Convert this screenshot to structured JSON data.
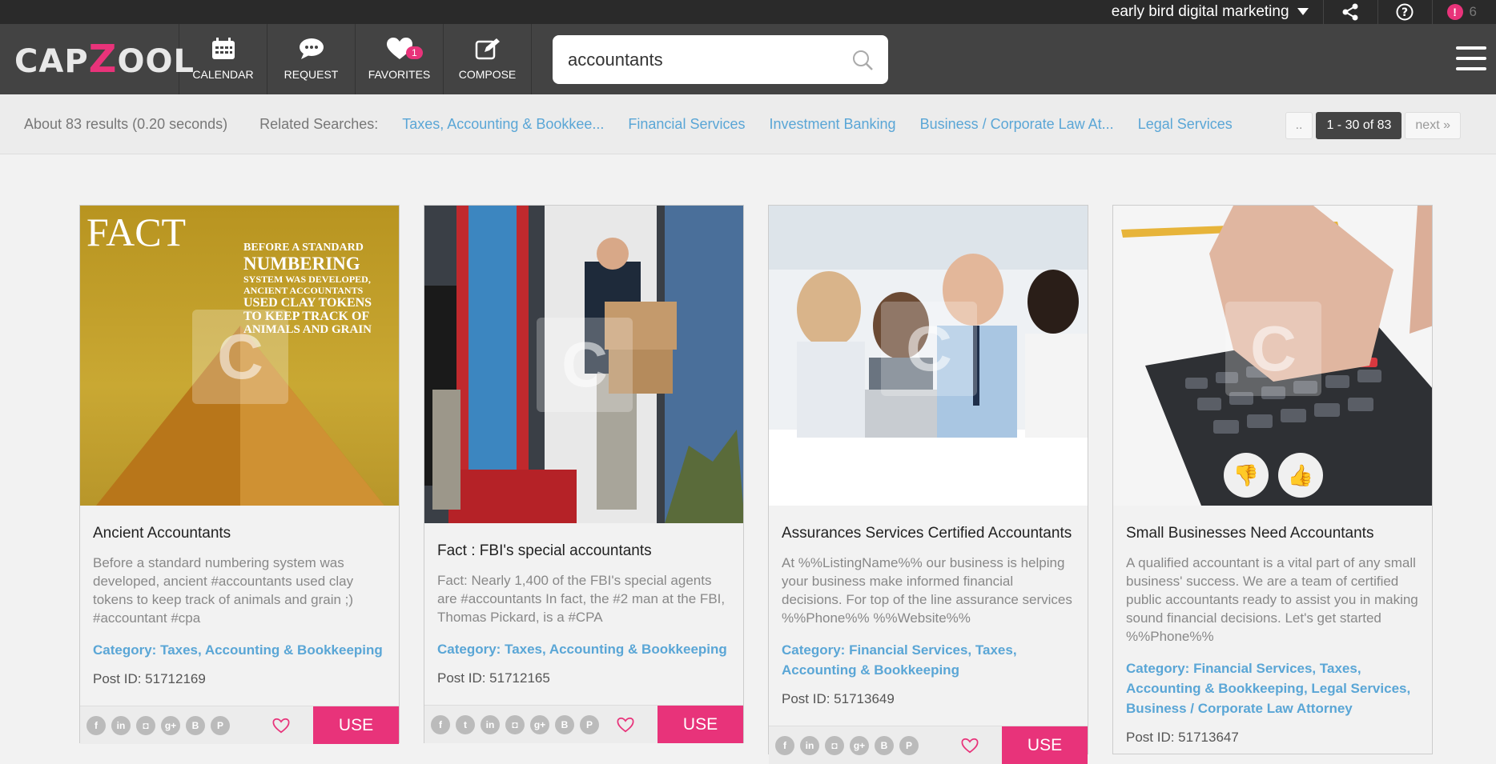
{
  "topbar": {
    "account_name": "early bird digital marketing",
    "notification_count": "6"
  },
  "logo": {
    "text_left": "CAP",
    "text_z": "Z",
    "text_right": "OOL"
  },
  "nav": {
    "calendar": "CALENDAR",
    "request": "REQUEST",
    "favorites": "FAVORITES",
    "favorites_count": "1",
    "compose": "COMPOSE"
  },
  "search": {
    "value": "accountants"
  },
  "results": {
    "summary": "About 83 results (0.20 seconds)",
    "related_label": "Related Searches:",
    "related": [
      "Taxes, Accounting & Bookkee...",
      "Financial Services",
      "Investment Banking",
      "Business / Corporate Law At...",
      "Legal Services"
    ],
    "pager_prev": "..",
    "pager_current": "1 - 30 of 83",
    "pager_next": "next »"
  },
  "cards": [
    {
      "title": "Ancient Accountants",
      "description": "Before a standard numbering system was developed, ancient #accountants used clay tokens to keep track of animals and grain ;) #accountant #cpa",
      "category": "Category: Taxes, Accounting & Bookkeeping",
      "post_id": "Post ID: 51712169",
      "image_fact": "FACT",
      "image_line1": "BEFORE A STANDARD",
      "image_line2": "NUMBERING",
      "image_line3": "SYSTEM WAS DEVELOPED,",
      "image_line4": "ANCIENT ACCOUNTANTS",
      "image_line5": "USED CLAY TOKENS",
      "image_line6": "TO KEEP TRACK OF",
      "image_line7": "ANIMALS AND GRAIN"
    },
    {
      "title": "Fact : FBI's special accountants",
      "description": "Fact: Nearly 1,400 of the FBI's special agents are #accountants In fact, the #2 man at the FBI, Thomas Pickard, is a #CPA",
      "category": "Category: Taxes, Accounting & Bookkeeping",
      "post_id": "Post ID: 51712165"
    },
    {
      "title": "Assurances Services Certified Accountants",
      "description": "At %%ListingName%% our business is helping your business make informed financial decisions. For top of the line assurance services %%Phone%% %%Website%%",
      "category": "Category: Financial Services, Taxes, Accounting & Bookkeeping",
      "post_id": "Post ID: 51713649"
    },
    {
      "title": "Small Businesses Need Accountants",
      "description": "A qualified accountant is a vital part of any small business' success. We are a team of certified public accountants ready to assist you in making sound financial decisions. Let's get started %%Phone%%",
      "category": "Category: Financial Services, Taxes, Accounting & Bookkeeping, Legal Services, Business / Corporate Law Attorney",
      "post_id": "Post ID: 51713647"
    }
  ],
  "use_label": "USE",
  "colors": {
    "accent": "#e8337a",
    "link": "#5aa6d6",
    "nav_bg": "#434343"
  }
}
